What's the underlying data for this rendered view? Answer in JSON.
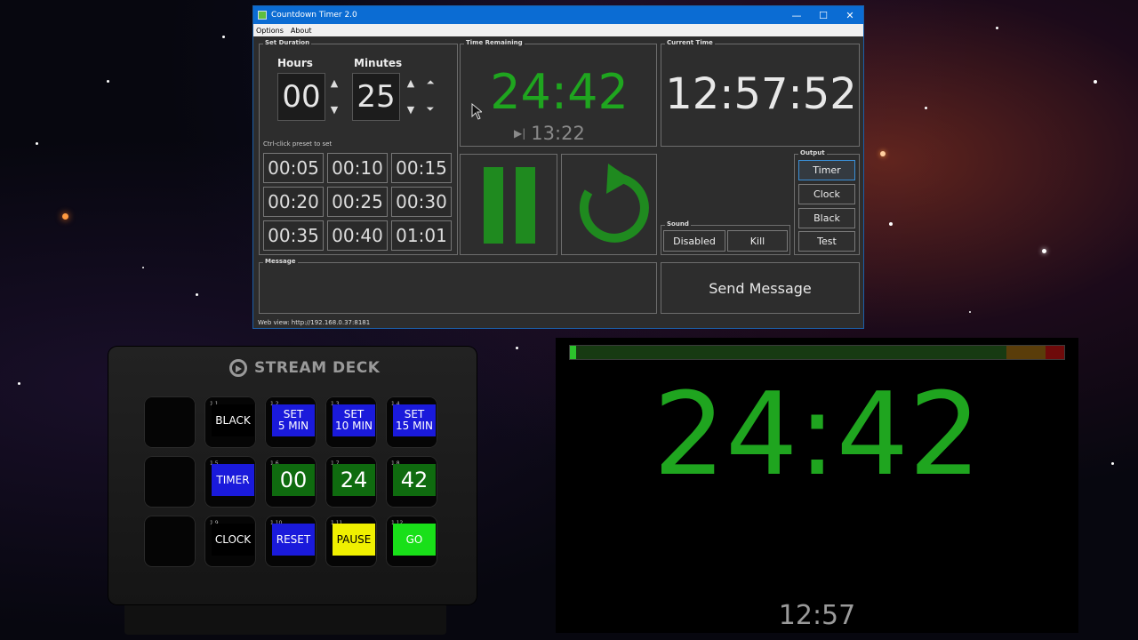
{
  "window": {
    "title": "Countdown Timer 2.0",
    "menu": [
      "Options",
      "About"
    ],
    "controls": {
      "minimize": "—",
      "maximize": "☐",
      "close": "✕"
    }
  },
  "set_duration": {
    "label": "Set Duration",
    "hours_label": "Hours",
    "minutes_label": "Minutes",
    "hours": "00",
    "minutes": "25",
    "hint": "Ctrl-click preset to set",
    "presets": [
      "00:05",
      "00:10",
      "00:15",
      "00:20",
      "00:25",
      "00:30",
      "00:35",
      "00:40",
      "01:01"
    ]
  },
  "time_remaining": {
    "label": "Time Remaining",
    "value": "24:42",
    "end_time": "13:22"
  },
  "current_time": {
    "label": "Current Time",
    "value": "12:57:52"
  },
  "output": {
    "label": "Output",
    "buttons": [
      "Timer",
      "Clock",
      "Black",
      "Test"
    ],
    "active": "Timer"
  },
  "sound": {
    "label": "Sound",
    "buttons": [
      "Disabled",
      "Kill"
    ]
  },
  "message": {
    "label": "Message",
    "send_label": "Send Message"
  },
  "status": {
    "web_view": "Web view: http://192.168.0.37:8181"
  },
  "stream_deck": {
    "logo": "STREAM DECK",
    "keys": [
      {
        "id": "",
        "label": "",
        "color": "#050505"
      },
      {
        "id": "1.1",
        "label": "BLACK",
        "color": "#000000"
      },
      {
        "id": "1.2",
        "label": "SET\n5 MIN",
        "color": "#1a1adb"
      },
      {
        "id": "1.3",
        "label": "SET\n10 MIN",
        "color": "#1a1adb"
      },
      {
        "id": "1.4",
        "label": "SET\n15 MIN",
        "color": "#1a1adb"
      },
      {
        "id": "",
        "label": "",
        "color": "#050505"
      },
      {
        "id": "1.5",
        "label": "TIMER",
        "color": "#1a1adb"
      },
      {
        "id": "1.6",
        "label": "00",
        "color": "#0f6b0f"
      },
      {
        "id": "1.7",
        "label": "24",
        "color": "#0f6b0f"
      },
      {
        "id": "1.8",
        "label": "42",
        "color": "#0f6b0f"
      },
      {
        "id": "",
        "label": "",
        "color": "#050505"
      },
      {
        "id": "1.9",
        "label": "CLOCK",
        "color": "#000000"
      },
      {
        "id": "1.10",
        "label": "RESET",
        "color": "#1a1adb"
      },
      {
        "id": "1.11",
        "label": "PAUSE",
        "color": "#f0f000"
      },
      {
        "id": "1.12",
        "label": "GO",
        "color": "#19e019"
      }
    ]
  },
  "display": {
    "timer": "24:42",
    "clock": "12:57",
    "progress_elapsed_fraction": 0.013,
    "colors": {
      "timer": "#1fa51f",
      "bar_green": "#173a12",
      "bar_amber": "#5a3d0a",
      "bar_red": "#6e0a0a"
    }
  }
}
